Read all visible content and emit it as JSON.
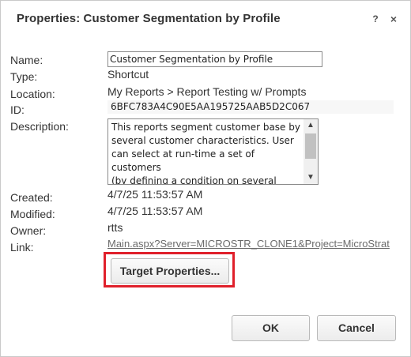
{
  "dialog": {
    "title": "Properties: Customer Segmentation by Profile",
    "help_glyph": "?",
    "close_glyph": "×"
  },
  "fields": {
    "name_label": "Name:",
    "name_value": "Customer Segmentation by Profile",
    "type_label": "Type:",
    "type_value": "Shortcut",
    "location_label": "Location:",
    "location_value": "My Reports > Report Testing w/ Prompts",
    "id_label": "ID:",
    "id_value": "6BFC783A4C90E5AA195725AAB5D2C067",
    "description_label": "Description:",
    "description_value": "This reports segment customer base by\nseveral customer characteristics. User\ncan select at run-time a set of customers\n(by defining a condition on several\ncustomer characteristics), and the",
    "created_label": "Created:",
    "created_value": "4/7/25 11:53:57 AM",
    "modified_label": "Modified:",
    "modified_value": "4/7/25 11:53:57 AM",
    "owner_label": "Owner:",
    "owner_value": "rtts",
    "link_label": "Link:",
    "link_value": "Main.aspx?Server=MICROSTR_CLONE1&Project=MicroStrat"
  },
  "buttons": {
    "target_properties": "Target Properties...",
    "ok": "OK",
    "cancel": "Cancel"
  },
  "icons": {
    "scroll_up": "▲",
    "scroll_down": "▼"
  },
  "colors": {
    "highlight": "#e0202b",
    "link": "#6b6b6b"
  }
}
